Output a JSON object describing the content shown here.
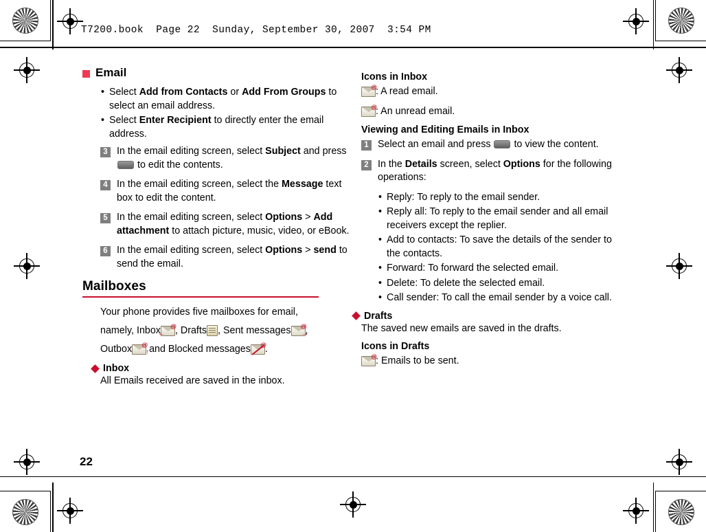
{
  "header": {
    "running_header": "T7200.book  Page 22  Sunday, September 30, 2007  3:54 PM"
  },
  "page": {
    "number": "22",
    "section_title": "Email",
    "mailboxes_title": "Mailboxes"
  },
  "left_column": {
    "bullets": [
      "Select Add from Contacts or Add From Groups to select an email address.",
      "Select Enter Recipient to directly enter the email address."
    ],
    "bullets_rich": [
      {
        "pre": "Select ",
        "b1": "Add from Contacts",
        "mid": " or ",
        "b2": "Add From Groups",
        "post": " to select an email address."
      },
      {
        "pre": "Select ",
        "b1": "Enter Recipient",
        "mid": "",
        "b2": "",
        "post": " to directly enter the email address."
      }
    ],
    "steps": [
      {
        "num": "3",
        "pre": "In the email editing screen, select ",
        "bold": "Subject",
        "mid": " and press ",
        "icon": "softkey-button",
        "post": " to edit the contents."
      },
      {
        "num": "4",
        "pre": "In the email editing screen, select the ",
        "bold": "Message",
        "mid": "",
        "icon": "",
        "post": " text box to edit the content."
      },
      {
        "num": "5",
        "pre": "In the email editing screen, select ",
        "bold": "Options",
        "mid": " > ",
        "bold2": "Add attachment",
        "post": " to attach picture, music, video, or eBook."
      },
      {
        "num": "6",
        "pre": "In the email editing screen, select ",
        "bold": "Options",
        "mid": " > ",
        "bold2": "send",
        "post": " to send the email."
      }
    ],
    "mailboxes_intro_1": "Your phone provides five mailboxes for email,",
    "mailboxes_intro_2a": "namely, Inbox",
    "mailboxes_intro_2b": ", Drafts",
    "mailboxes_intro_2c": ", Sent messages",
    "mailboxes_intro_2d": ",",
    "mailboxes_intro_3a": "Outbox",
    "mailboxes_intro_3b": " and Blocked messages",
    "mailboxes_intro_3c": ".",
    "inbox_head": "Inbox",
    "inbox_text": "All Emails received are saved in the inbox."
  },
  "right_column": {
    "icons_in_inbox_head": "Icons in Inbox",
    "icon_read": ": A read email.",
    "icon_unread": ": An unread email.",
    "viewing_head": "Viewing and Editing Emails in Inbox",
    "steps": [
      {
        "num": "1",
        "pre": "Select an email and press ",
        "icon": "softkey-button",
        "post": " to view the content."
      },
      {
        "num": "2",
        "pre": "In the ",
        "bold": "Details",
        "mid": " screen, select ",
        "bold2": "Options",
        "post": " for the following operations:"
      }
    ],
    "operations": [
      "Reply: To reply to the email sender.",
      "Reply all: To reply to the email sender and all email receivers except the replier.",
      "Add to contacts: To save the details of the sender to the contacts.",
      "Forward: To forward the selected email.",
      "Delete: To delete the selected email.",
      "Call sender: To call the email sender by a voice call."
    ],
    "drafts_head": "Drafts",
    "drafts_text": "The saved new emails are saved in the drafts.",
    "icons_in_drafts_head": "Icons in Drafts",
    "icon_to_be_sent": ": Emails to be sent."
  },
  "colors": {
    "accent_red": "#c8102e",
    "bullet_square": "#ee3a53",
    "step_number_bg": "#7f7f7f"
  }
}
